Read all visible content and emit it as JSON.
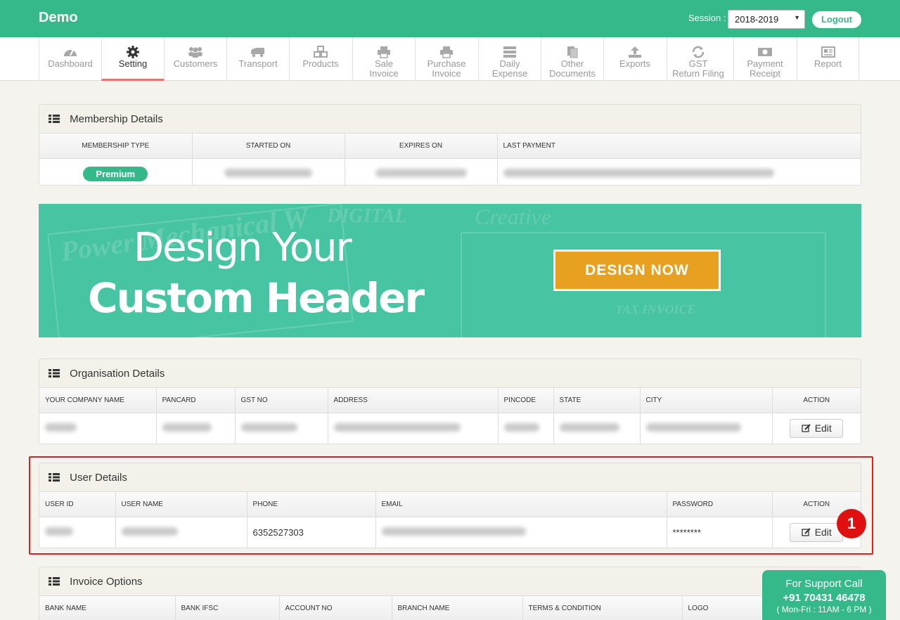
{
  "app": {
    "brand": "Demo"
  },
  "session": {
    "label": "Session :",
    "value": "2018-2019"
  },
  "header": {
    "logout_label": "Logout"
  },
  "nav": [
    {
      "l1": "Dashboard",
      "l2": "",
      "icon": "gauge-icon"
    },
    {
      "l1": "Setting",
      "l2": "",
      "icon": "gear-icon"
    },
    {
      "l1": "Customers",
      "l2": "",
      "icon": "users-icon"
    },
    {
      "l1": "Transport",
      "l2": "",
      "icon": "truck-icon"
    },
    {
      "l1": "Products",
      "l2": "",
      "icon": "cubes-icon"
    },
    {
      "l1": "Sale",
      "l2": "Invoice",
      "icon": "printer-icon"
    },
    {
      "l1": "Purchase",
      "l2": "Invoice",
      "icon": "printer-icon"
    },
    {
      "l1": "Daily",
      "l2": "Expense",
      "icon": "server-icon"
    },
    {
      "l1": "Other",
      "l2": "Documents",
      "icon": "documents-icon"
    },
    {
      "l1": "Exports",
      "l2": "",
      "icon": "upload-icon"
    },
    {
      "l1": "GST",
      "l2": "Return Filing",
      "icon": "refresh-icon"
    },
    {
      "l1": "Payment",
      "l2": "Receipt",
      "icon": "money-icon"
    },
    {
      "l1": "Report",
      "l2": "",
      "icon": "newspaper-icon"
    }
  ],
  "membership": {
    "title": "Membership Details",
    "columns": [
      "MEMBERSHIP TYPE",
      "STARTED ON",
      "EXPIRES ON",
      "LAST PAYMENT"
    ],
    "type_badge": "Premium"
  },
  "banner": {
    "line1": "Design Your",
    "line2": "Custom Header",
    "button": "DESIGN NOW",
    "bg_text_1": "Power Mechanical W",
    "bg_text_2": "DIGITAL",
    "bg_text_3": "TAX INVOICE",
    "bg_text_4": "Creative"
  },
  "organisation": {
    "title": "Organisation Details",
    "columns": [
      "YOUR COMPANY NAME",
      "PANCARD",
      "GST NO",
      "ADDRESS",
      "PINCODE",
      "STATE",
      "CITY",
      "ACTION"
    ],
    "edit_label": "Edit"
  },
  "user": {
    "title": "User Details",
    "columns": [
      "USER ID",
      "USER NAME",
      "PHONE",
      "EMAIL",
      "PASSWORD",
      "ACTION"
    ],
    "phone": "6352527303",
    "password": "********",
    "edit_label": "Edit"
  },
  "invoice_options": {
    "title": "Invoice Options",
    "columns": [
      "BANK NAME",
      "BANK IFSC",
      "ACCOUNT NO",
      "BRANCH NAME",
      "TERMS & CONDITION",
      "LOGO"
    ]
  },
  "annotation": {
    "step": "1"
  },
  "support": {
    "line1": "For Support Call",
    "phone": "+91 70431 46478",
    "hours": "( Mon-Fri : 11AM - 6 PM )"
  },
  "colors": {
    "primary": "#35b98a",
    "accent_orange": "#e8a020",
    "highlight_red": "#e01e1e"
  }
}
